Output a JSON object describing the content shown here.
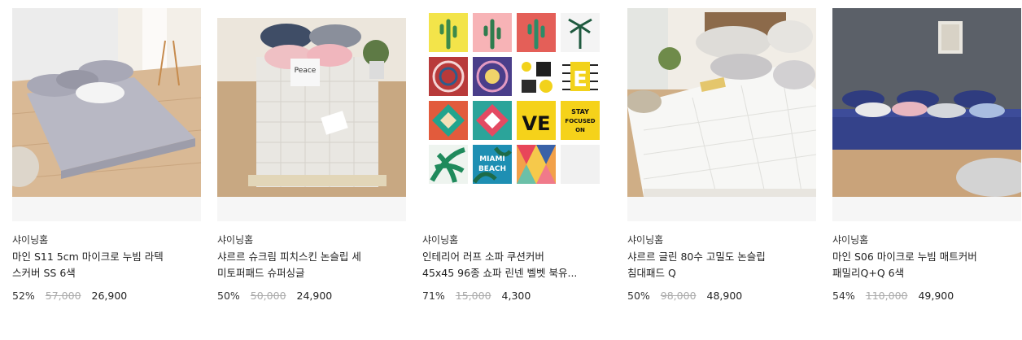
{
  "products": [
    {
      "image_alt": "",
      "brand": "샤이닝홈",
      "title": "마인 S11 5cm 마이크로 누빔 라텍\n스커버 SS 6색",
      "discount": "52%",
      "original_price": "57,000",
      "sale_price": "26,900"
    },
    {
      "image_alt": "",
      "brand": "샤이닝홈",
      "title": "샤르르 슈크림 피치스킨 논슬립 세\n미토퍼패드 슈퍼싱글",
      "discount": "50%",
      "original_price": "50,000",
      "sale_price": "24,900"
    },
    {
      "image_alt": "",
      "brand": "샤이닝홈",
      "title": "인테리어 러프 소파 쿠션커버\n45x45 96종 쇼파 린넨 벨벳 북유...",
      "discount": "71%",
      "original_price": "15,000",
      "sale_price": "4,300"
    },
    {
      "image_alt": "",
      "brand": "샤이닝홈",
      "title": "샤르르 글린 80수 고밀도 논슬립\n침대패드 Q",
      "discount": "50%",
      "original_price": "98,000",
      "sale_price": "48,900"
    },
    {
      "image_alt": "",
      "brand": "샤이닝홈",
      "title": "마인 S06 마이크로 누빔 매트커버\n패밀리Q+Q 6색",
      "discount": "54%",
      "original_price": "110,000",
      "sale_price": "49,900"
    }
  ],
  "cushion_texts": [
    "Peace",
    "MIAMI",
    "BEACH",
    "VE",
    "STAY",
    "FOCUSED",
    "ON"
  ],
  "colors": {
    "price_strike": "#aaaaaa",
    "text": "#222222",
    "thumb_bg": "#f6f6f6"
  }
}
